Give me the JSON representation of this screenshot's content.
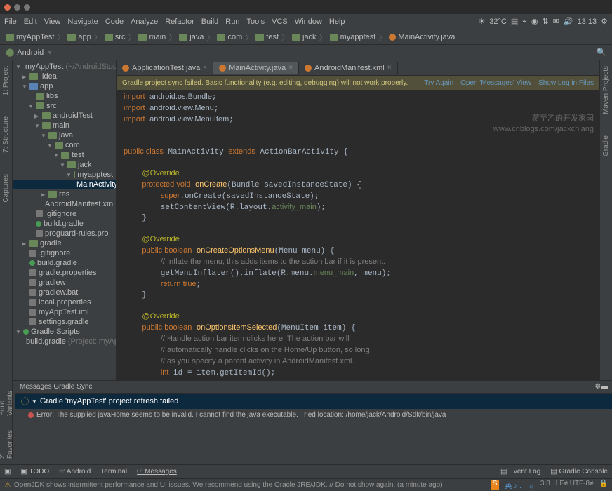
{
  "menu": [
    "File",
    "Edit",
    "View",
    "Navigate",
    "Code",
    "Analyze",
    "Refactor",
    "Build",
    "Run",
    "Tools",
    "VCS",
    "Window",
    "Help"
  ],
  "top_right": {
    "temp": "32°C",
    "time": "13:13"
  },
  "breadcrumbs": [
    "myAppTest",
    "app",
    "src",
    "main",
    "java",
    "com",
    "test",
    "jack",
    "myapptest",
    "MainActivity.java"
  ],
  "toolbar2": {
    "config": "Android"
  },
  "left_tabs": [
    "1: Project",
    "7: Structure",
    "Captures"
  ],
  "right_tabs": [
    "Maven Projects",
    "Gradle"
  ],
  "tree": [
    {
      "d": 0,
      "a": "▼",
      "i": "folder",
      "t": "myAppTest",
      "suffix": "(~/AndroidStudioProjects/m"
    },
    {
      "d": 1,
      "a": "▶",
      "i": "folder",
      "t": ".idea"
    },
    {
      "d": 1,
      "a": "▼",
      "i": "folder-blue",
      "t": "app"
    },
    {
      "d": 2,
      "a": "",
      "i": "folder",
      "t": "libs"
    },
    {
      "d": 2,
      "a": "▼",
      "i": "folder",
      "t": "src"
    },
    {
      "d": 3,
      "a": "▶",
      "i": "folder",
      "t": "androidTest"
    },
    {
      "d": 3,
      "a": "▼",
      "i": "folder",
      "t": "main"
    },
    {
      "d": 4,
      "a": "▼",
      "i": "folder",
      "t": "java"
    },
    {
      "d": 5,
      "a": "▼",
      "i": "folder",
      "t": "com"
    },
    {
      "d": 6,
      "a": "▼",
      "i": "folder",
      "t": "test"
    },
    {
      "d": 7,
      "a": "▼",
      "i": "folder",
      "t": "jack"
    },
    {
      "d": 8,
      "a": "▼",
      "i": "folder",
      "t": "myapptest"
    },
    {
      "d": 9,
      "a": "",
      "i": "java",
      "t": "MainActivity.jav",
      "sel": true
    },
    {
      "d": 4,
      "a": "▶",
      "i": "folder",
      "t": "res"
    },
    {
      "d": 4,
      "a": "",
      "i": "file",
      "t": "AndroidManifest.xml"
    },
    {
      "d": 2,
      "a": "",
      "i": "file",
      "t": ".gitignore"
    },
    {
      "d": 2,
      "a": "",
      "i": "gradle",
      "t": "build.gradle"
    },
    {
      "d": 2,
      "a": "",
      "i": "file",
      "t": "proguard-rules.pro"
    },
    {
      "d": 1,
      "a": "▶",
      "i": "folder",
      "t": "gradle"
    },
    {
      "d": 1,
      "a": "",
      "i": "file",
      "t": ".gitignore"
    },
    {
      "d": 1,
      "a": "",
      "i": "gradle",
      "t": "build.gradle"
    },
    {
      "d": 1,
      "a": "",
      "i": "file",
      "t": "gradle.properties"
    },
    {
      "d": 1,
      "a": "",
      "i": "file",
      "t": "gradlew"
    },
    {
      "d": 1,
      "a": "",
      "i": "file",
      "t": "gradlew.bat"
    },
    {
      "d": 1,
      "a": "",
      "i": "file",
      "t": "local.properties"
    },
    {
      "d": 1,
      "a": "",
      "i": "file",
      "t": "myAppTest.iml"
    },
    {
      "d": 1,
      "a": "",
      "i": "file",
      "t": "settings.gradle"
    },
    {
      "d": 0,
      "a": "▼",
      "i": "gradle",
      "t": "Gradle Scripts"
    },
    {
      "d": 1,
      "a": "",
      "i": "gradle",
      "t": "build.gradle",
      "suffix": "(Project: myAppTest)"
    }
  ],
  "editor_tabs": [
    {
      "label": "ApplicationTest.java",
      "active": false
    },
    {
      "label": "MainActivity.java",
      "active": true
    },
    {
      "label": "AndroidManifest.xml",
      "active": false
    }
  ],
  "warning": {
    "msg": "Gradle project sync failed. Basic functionality (e.g. editing, debugging) will not work properly.",
    "links": [
      "Try Again",
      "Open 'Messages' View",
      "Show Log in Files"
    ]
  },
  "watermark": {
    "l1": "蒋至乙的开发家园",
    "l2": "www.cnblogs.com/jackchiang"
  },
  "messages": {
    "header": "Messages Gradle Sync",
    "title": "Gradle 'myAppTest' project refresh failed",
    "error": "Error: The supplied javaHome seems to be invalid. I cannot find the java executable. Tried location: /home/jack/Android/Sdk/bin/java"
  },
  "bottom_tabs_left": [
    "TODO",
    "6: Android",
    "Terminal",
    "0: Messages"
  ],
  "bottom_tabs_right": [
    "Event Log",
    "Gradle Console"
  ],
  "status": {
    "msg": "OpenJDK shows intermittent performance and UI issues. We recommend using the Oracle JRE/JDK. // Do not show again. (a minute ago)",
    "pos": "3:8",
    "enc": "LF≠ UTF-8≠"
  }
}
